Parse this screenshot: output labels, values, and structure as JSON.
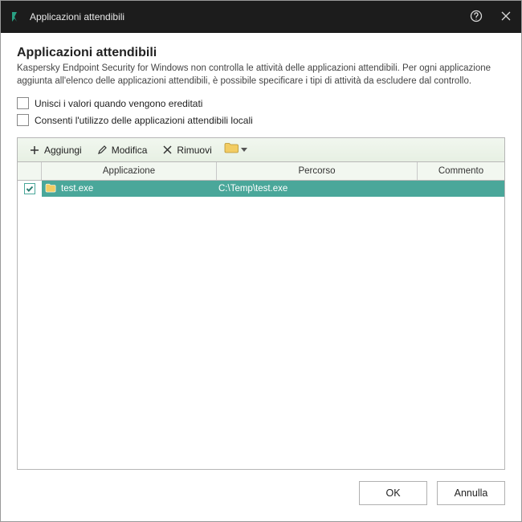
{
  "window": {
    "title": "Applicazioni attendibili"
  },
  "content": {
    "heading": "Applicazioni attendibili",
    "description": "Kaspersky Endpoint Security for Windows non controlla le attività delle applicazioni attendibili. Per ogni applicazione aggiunta all'elenco delle applicazioni attendibili, è possibile specificare i tipi di attività da escludere dal controllo.",
    "checkbox1": "Unisci i valori quando vengono ereditati",
    "checkbox2": "Consenti l'utilizzo delle applicazioni attendibili locali"
  },
  "toolbar": {
    "add": "Aggiungi",
    "edit": "Modifica",
    "remove": "Rimuovi"
  },
  "columns": {
    "app": "Applicazione",
    "path": "Percorso",
    "comment": "Commento"
  },
  "rows": [
    {
      "checked": true,
      "name": "test.exe",
      "path": "C:\\Temp\\test.exe",
      "comment": ""
    }
  ],
  "footer": {
    "ok": "OK",
    "cancel": "Annulla"
  }
}
